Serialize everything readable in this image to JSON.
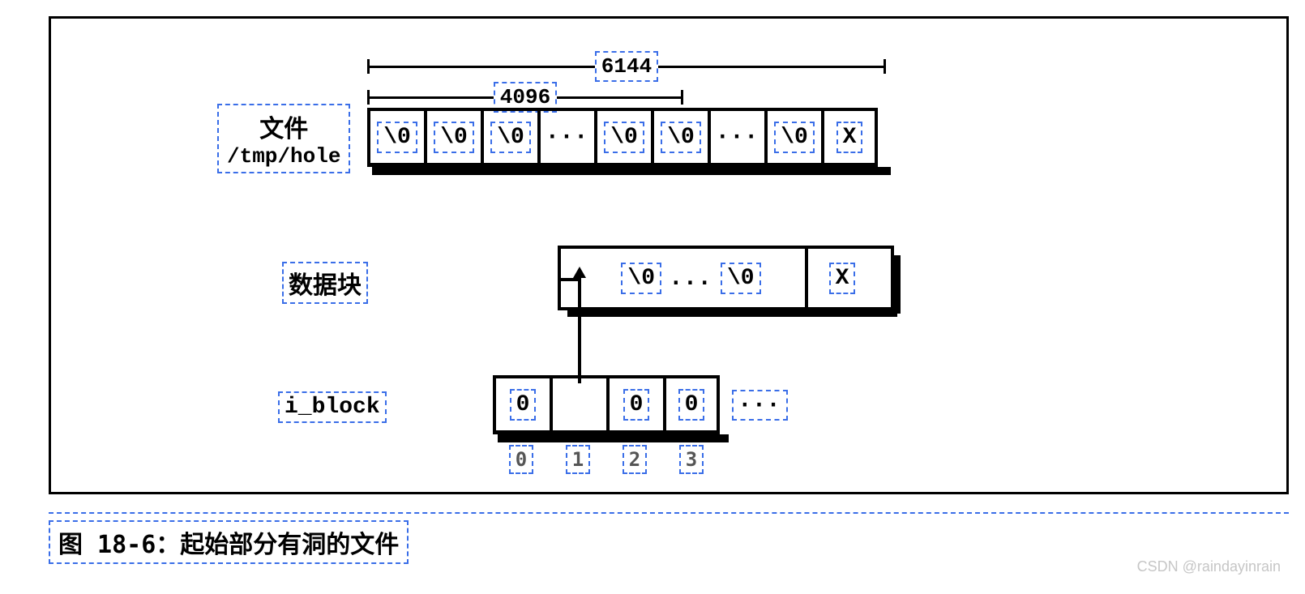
{
  "dimensions": {
    "total": "6144",
    "hole": "4096"
  },
  "file_label": {
    "line1": "文件",
    "line2": "/tmp/hole"
  },
  "file_cells": [
    "\\0",
    "\\0",
    "\\0",
    "···",
    "\\0",
    "\\0",
    "···",
    "\\0",
    "X"
  ],
  "datablock": {
    "label": "数据块",
    "cells": [
      "\\0",
      "...",
      "\\0",
      "X"
    ]
  },
  "iblock": {
    "label": "i_block",
    "cells": [
      "0",
      "",
      "0",
      "0"
    ],
    "ellipsis": "···",
    "indices": [
      "0",
      "1",
      "2",
      "3"
    ]
  },
  "caption": "图 18-6：起始部分有洞的文件",
  "watermark": "CSDN @raindayinrain"
}
